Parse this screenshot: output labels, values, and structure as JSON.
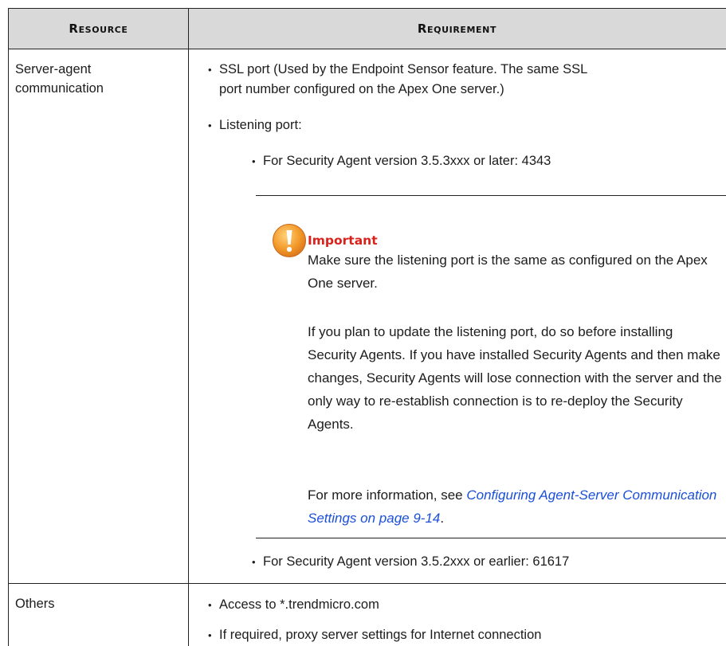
{
  "table": {
    "headers": {
      "resource": "Resource",
      "requirement": "Requirement"
    },
    "rows": [
      {
        "resource_line1": "Server-agent",
        "resource_line2": "communication",
        "items": [
          {
            "line1": "SSL port (Used by the Endpoint Sensor feature. The same SSL",
            "line2": "port number configured on the Apex One server.)"
          },
          {
            "text": "Listening port:"
          }
        ],
        "subitems": [
          {
            "text": "For Security Agent version 3.5.3xxx or later: 4343"
          },
          {
            "text": "For Security Agent version 3.5.2xxx or earlier: 61617"
          }
        ],
        "note": {
          "icon": "warning-exclamation-icon",
          "title": "Important",
          "para1": "Make sure the listening port is the same as configured on the Apex One server.",
          "para2": "If you plan to update the listening port, do so before installing Security Agents. If you have installed Security Agents and then make changes, Security Agents will lose connection with the server and the only way to re-establish connection is to re-deploy the Security Agents.",
          "para3_prefix": "For more information, see ",
          "para3_link": "Configuring Agent-Server Communication Settings on page 9-14",
          "para3_suffix": "."
        }
      },
      {
        "resource": "Others",
        "items": [
          {
            "text": "Access to *.trendmicro.com"
          },
          {
            "text": "If required, proxy server settings for Internet connection"
          }
        ]
      }
    ]
  },
  "colors": {
    "header_bg": "#d9d9d9",
    "important_title": "#d9221b",
    "link": "#1a4fd8",
    "icon_orange": "#f39a2b"
  }
}
